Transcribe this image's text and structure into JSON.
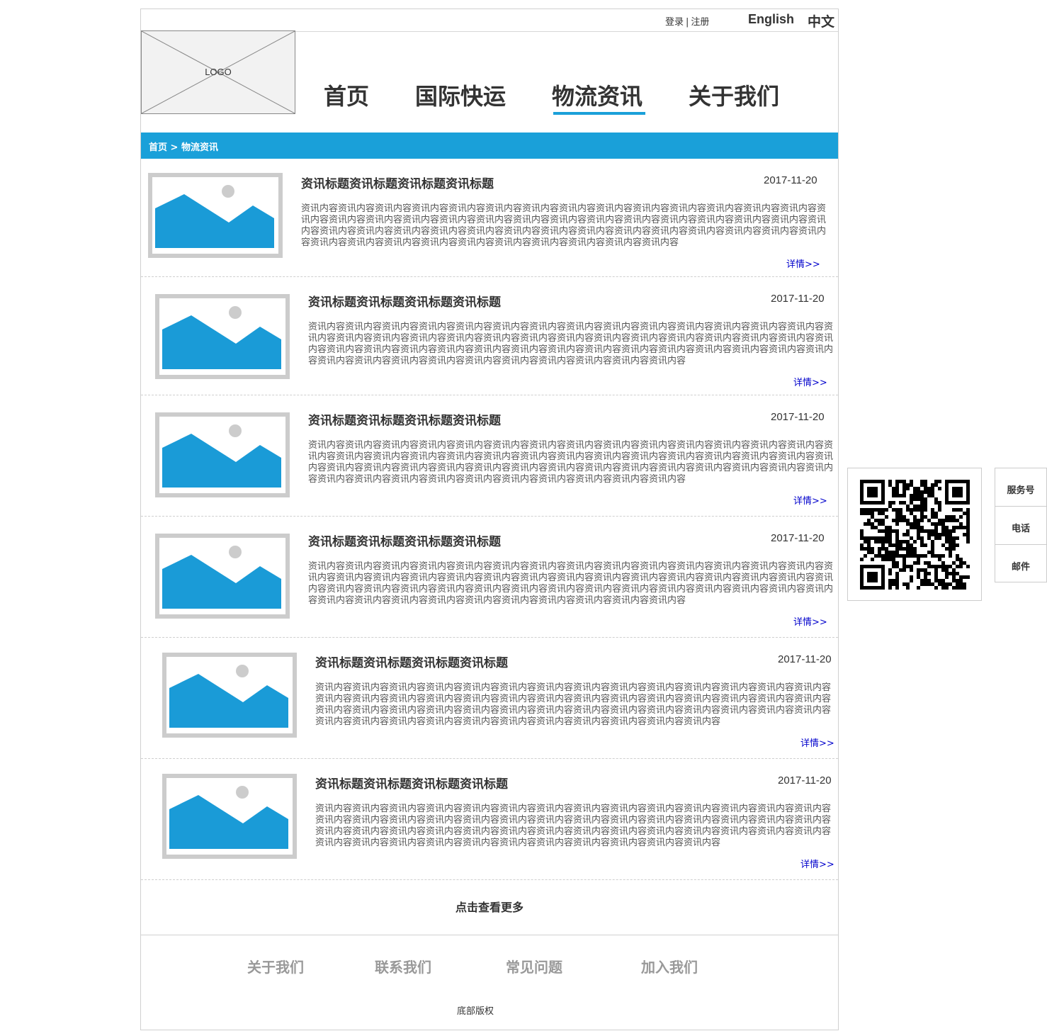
{
  "header": {
    "login": "登录",
    "register": "注册",
    "lang_en": "English",
    "lang_zh": "中文",
    "logo": "LOGO"
  },
  "nav": [
    "首页",
    "国际快运",
    "物流资讯",
    "关于我们"
  ],
  "active_nav": "物流资讯",
  "breadcrumb": "首页 > 物流资讯",
  "news": [
    {
      "title": "资讯标题资讯标题资讯标题资讯标题",
      "date": "2017-11-20",
      "content": "资讯内容资讯内容资讯内容资讯内容资讯内容资讯内容资讯内容资讯内容资讯内容资讯内容资讯内容资讯内容资讯内容资讯内容资讯内容资讯内容资讯内容资讯内容资讯内容资讯内容资讯内容资讯内容资讯内容资讯内容资讯内容资讯内容资讯内容资讯内容资讯内容资讯内容资讯内容资讯内容资讯内容资讯内容资讯内容资讯内容资讯内容资讯内容资讯内容资讯内容资讯内容资讯内容资讯内容资讯内容资讯内容资讯内容资讯内容资讯内容资讯内容资讯内容资讯内容资讯内容资讯内容",
      "detail": "详情>>"
    },
    {
      "title": "资讯标题资讯标题资讯标题资讯标题",
      "date": "2017-11-20",
      "content": "资讯内容资讯内容资讯内容资讯内容资讯内容资讯内容资讯内容资讯内容资讯内容资讯内容资讯内容资讯内容资讯内容资讯内容资讯内容资讯内容资讯内容资讯内容资讯内容资讯内容资讯内容资讯内容资讯内容资讯内容资讯内容资讯内容资讯内容资讯内容资讯内容资讯内容资讯内容资讯内容资讯内容资讯内容资讯内容资讯内容资讯内容资讯内容资讯内容资讯内容资讯内容资讯内容资讯内容资讯内容资讯内容资讯内容资讯内容资讯内容资讯内容资讯内容资讯内容资讯内容资讯内容",
      "detail": "详情>>"
    },
    {
      "title": "资讯标题资讯标题资讯标题资讯标题",
      "date": "2017-11-20",
      "content": "资讯内容资讯内容资讯内容资讯内容资讯内容资讯内容资讯内容资讯内容资讯内容资讯内容资讯内容资讯内容资讯内容资讯内容资讯内容资讯内容资讯内容资讯内容资讯内容资讯内容资讯内容资讯内容资讯内容资讯内容资讯内容资讯内容资讯内容资讯内容资讯内容资讯内容资讯内容资讯内容资讯内容资讯内容资讯内容资讯内容资讯内容资讯内容资讯内容资讯内容资讯内容资讯内容资讯内容资讯内容资讯内容资讯内容资讯内容资讯内容资讯内容资讯内容资讯内容资讯内容资讯内容",
      "detail": "详情>>"
    },
    {
      "title": "资讯标题资讯标题资讯标题资讯标题",
      "date": "2017-11-20",
      "content": "资讯内容资讯内容资讯内容资讯内容资讯内容资讯内容资讯内容资讯内容资讯内容资讯内容资讯内容资讯内容资讯内容资讯内容资讯内容资讯内容资讯内容资讯内容资讯内容资讯内容资讯内容资讯内容资讯内容资讯内容资讯内容资讯内容资讯内容资讯内容资讯内容资讯内容资讯内容资讯内容资讯内容资讯内容资讯内容资讯内容资讯内容资讯内容资讯内容资讯内容资讯内容资讯内容资讯内容资讯内容资讯内容资讯内容资讯内容资讯内容资讯内容资讯内容资讯内容资讯内容资讯内容",
      "detail": "详情>>"
    },
    {
      "title": "资讯标题资讯标题资讯标题资讯标题",
      "date": "2017-11-20",
      "content": "资讯内容资讯内容资讯内容资讯内容资讯内容资讯内容资讯内容资讯内容资讯内容资讯内容资讯内容资讯内容资讯内容资讯内容资讯内容资讯内容资讯内容资讯内容资讯内容资讯内容资讯内容资讯内容资讯内容资讯内容资讯内容资讯内容资讯内容资讯内容资讯内容资讯内容资讯内容资讯内容资讯内容资讯内容资讯内容资讯内容资讯内容资讯内容资讯内容资讯内容资讯内容资讯内容资讯内容资讯内容资讯内容资讯内容资讯内容资讯内容资讯内容资讯内容资讯内容资讯内容资讯内容",
      "detail": "详情>>"
    },
    {
      "title": "资讯标题资讯标题资讯标题资讯标题",
      "date": "2017-11-20",
      "content": "资讯内容资讯内容资讯内容资讯内容资讯内容资讯内容资讯内容资讯内容资讯内容资讯内容资讯内容资讯内容资讯内容资讯内容资讯内容资讯内容资讯内容资讯内容资讯内容资讯内容资讯内容资讯内容资讯内容资讯内容资讯内容资讯内容资讯内容资讯内容资讯内容资讯内容资讯内容资讯内容资讯内容资讯内容资讯内容资讯内容资讯内容资讯内容资讯内容资讯内容资讯内容资讯内容资讯内容资讯内容资讯内容资讯内容资讯内容资讯内容资讯内容资讯内容资讯内容资讯内容资讯内容",
      "detail": "详情>>"
    }
  ],
  "load_more": "点击查看更多",
  "footer": {
    "links": [
      "关于我们",
      "联系我们",
      "常见问题",
      "加入我们"
    ],
    "copyright": "底部版权"
  },
  "side": {
    "items": [
      "服务号",
      "电话",
      "邮件"
    ]
  },
  "colors": {
    "accent": "#1aa0d9",
    "link": "#0000cc"
  }
}
